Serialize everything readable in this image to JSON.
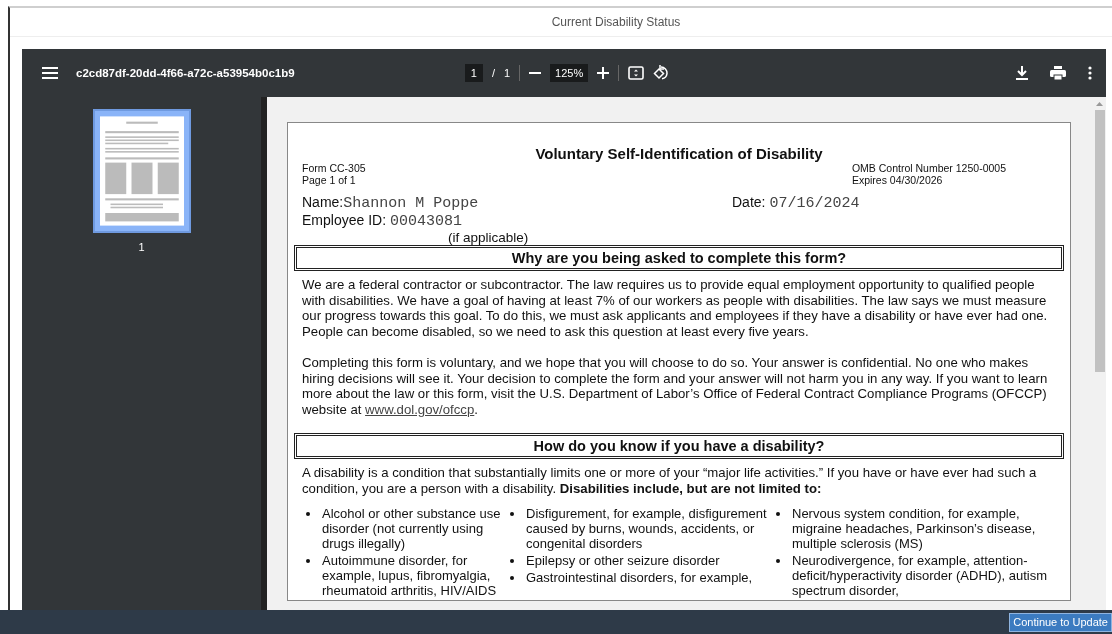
{
  "window": {
    "title": "Current Disability Status"
  },
  "viewer": {
    "file_name": "c2cd87df-20dd-4f66-a72c-a53954b0c1b9",
    "page_current": "1",
    "page_separator": "/",
    "page_total": "1",
    "zoom": "125%"
  },
  "thumbnails": [
    {
      "label": "1",
      "selected": true
    }
  ],
  "document": {
    "title": "Voluntary Self-Identification of Disability",
    "form_number": "Form CC-305",
    "page": "Page 1 of 1",
    "omb": "OMB Control Number 1250-0005",
    "expires": "Expires 04/30/2026",
    "name_label": "Name:",
    "name_value": "Shannon M Poppe",
    "date_label": "Date:",
    "date_value": "07/16/2024",
    "employee_id_label": "Employee ID:",
    "employee_id_value": "00043081",
    "if_applicable": "(if applicable)",
    "sections": [
      {
        "heading": "Why are you being asked to complete this form?",
        "paragraphs": [
          {
            "text": "We are a federal contractor or subcontractor. The law requires us to provide equal employment opportunity to qualified people with disabilities. We have a goal of having at least 7% of our workers as people with disabilities. The law says we must measure our progress towards this goal. To do this, we must ask applicants and employees if they have a disability or have ever had one. People can become disabled, so we need to ask this question at least every five years."
          },
          {
            "text": "Completing this form is voluntary, and we hope that you will choose to do so. Your answer is confidential. No one who makes hiring decisions will see it. Your decision to complete the form and your answer will not harm you in any way. If you want to learn more about the law or this form, visit the U.S. Department of Labor’s Office of Federal Contract Compliance Programs (OFCCP) website at",
            "link": "www.dol.gov/ofccp",
            "after": "."
          }
        ]
      },
      {
        "heading": "How do you know if you have a disability?",
        "paragraphs": [
          {
            "text": "A disability is a condition that substantially limits one or more of your “major life activities.” If you have or have ever had such a condition, you are a person with a disability. **Disabilities include, but are not limited to:**"
          }
        ],
        "bullet_columns": [
          [
            "Alcohol or other substance use disorder (not currently using drugs illegally)",
            "Autoimmune disorder, for example, lupus, fibromyalgia, rheumatoid arthritis, HIV/AIDS"
          ],
          [
            "Disfigurement, for example, disfigurement caused by burns, wounds, accidents, or congenital disorders",
            "Epilepsy or other seizure disorder",
            "Gastrointestinal disorders, for example,"
          ],
          [
            "Nervous system condition, for example, migraine headaches, Parkinson’s disease, multiple sclerosis (MS)",
            "Neurodivergence, for example, attention-deficit/hyperactivity disorder (ADHD), autism spectrum disorder,"
          ]
        ]
      }
    ]
  },
  "footer": {
    "button": "Continue to Update"
  }
}
